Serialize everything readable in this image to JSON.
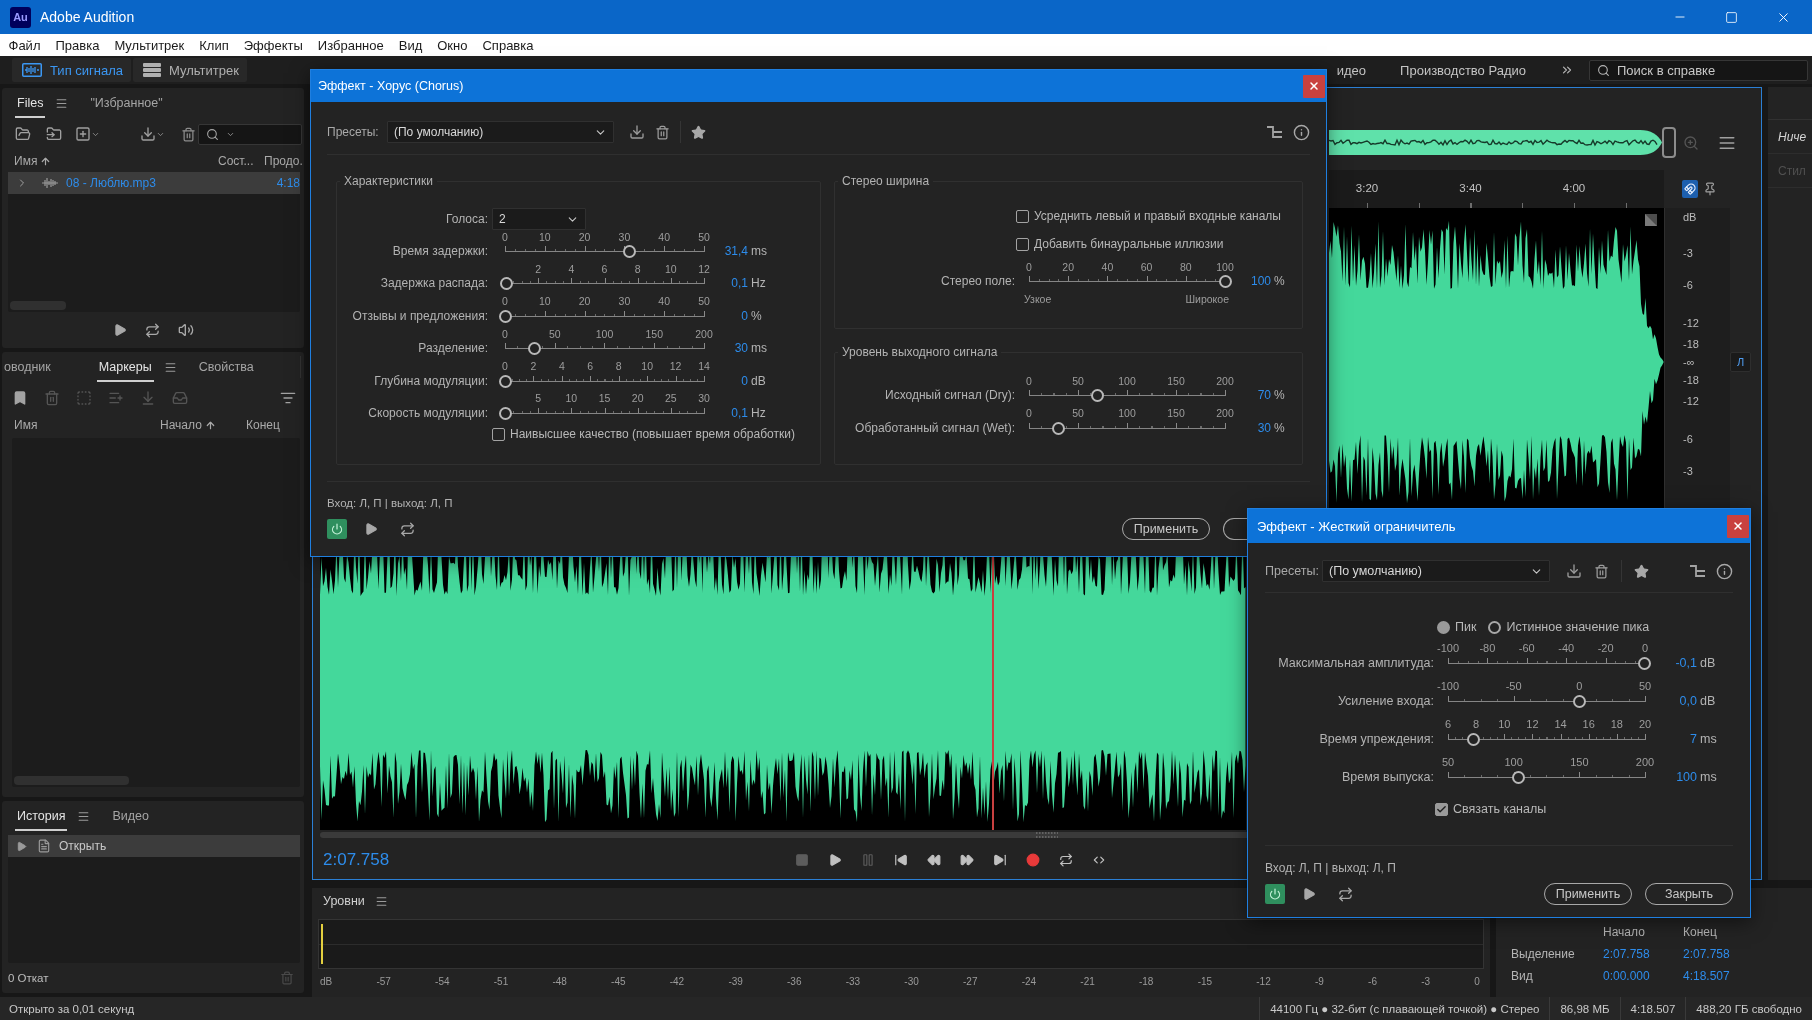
{
  "window": {
    "logo": "Au",
    "title": "Adobe Audition"
  },
  "menu": [
    "Файл",
    "Правка",
    "Мультитрек",
    "Клип",
    "Эффекты",
    "Избранное",
    "Вид",
    "Окно",
    "Справка"
  ],
  "toolbar": {
    "modes": [
      {
        "label": "Тип сигнала",
        "selected": true
      },
      {
        "label": "Мультитрек",
        "selected": false
      }
    ],
    "workspaces": [
      "идео",
      "Производство Радио"
    ],
    "search": {
      "placeholder": "Поиск в справке"
    }
  },
  "files_panel": {
    "tabs": [
      {
        "label": "Files",
        "selected": true
      },
      {
        "label": "\"Избранное\"",
        "selected": false
      }
    ],
    "columns": [
      {
        "label": "Имя",
        "sorted": true
      },
      {
        "label": "Сост...",
        "sorted": false
      },
      {
        "label": "Продо.",
        "sorted": false
      }
    ],
    "rows": [
      {
        "name": "08 - Люблю.mp3",
        "duration": "4:18",
        "selected": true,
        "expanded": false
      }
    ]
  },
  "markers_panel": {
    "tabs": [
      {
        "label": "оводник",
        "selected": false
      },
      {
        "label": "Маркеры",
        "selected": true
      },
      {
        "label": "Свойства",
        "selected": false
      }
    ],
    "columns": [
      {
        "label": "Имя",
        "sorted": false
      },
      {
        "label": "Начало",
        "sorted": true
      },
      {
        "label": "Конец",
        "sorted": false
      }
    ]
  },
  "history_panel": {
    "tabs": [
      {
        "label": "История",
        "selected": true
      },
      {
        "label": "Видео",
        "selected": false
      }
    ],
    "rows": [
      {
        "label": "Открыть",
        "selected": true
      }
    ],
    "undo_count": "0 Откат"
  },
  "editor": {
    "ruler": [
      "3:20",
      "3:40",
      "4:00"
    ],
    "scale": [
      "dB",
      "-3",
      "-6",
      "-12",
      "-18",
      "-∞",
      "-18",
      "-12",
      "-6",
      "-3"
    ],
    "channel_button": "Л",
    "time": "2:07.758"
  },
  "side_panel": {
    "items": [
      {
        "label": "Ниче",
        "kind": "value"
      },
      {
        "label": "Стил",
        "kind": "label"
      }
    ]
  },
  "levels": {
    "title": "Уровни",
    "scale": [
      "dB",
      "-57",
      "-54",
      "-51",
      "-48",
      "-45",
      "-42",
      "-39",
      "-36",
      "-33",
      "-30",
      "-27",
      "-24",
      "-21",
      "-18",
      "-15",
      "-12",
      "-9",
      "-6",
      "-3",
      "0"
    ]
  },
  "selection": {
    "columns": [
      "Начало",
      "Конец"
    ],
    "rows": [
      {
        "label": "Выделение",
        "start": "2:07.758",
        "end": "2:07.758"
      },
      {
        "label": "Вид",
        "start": "0:00.000",
        "end": "4:18.507"
      }
    ]
  },
  "chorus_dialog": {
    "title": "Эффект - Хорус (Chorus)",
    "presets_label": "Пресеты:",
    "preset": "(По умолчанию)",
    "characteristics": {
      "title": "Характеристики",
      "voices_label": "Голоса:",
      "voices": "2",
      "sliders": [
        {
          "label": "Время задержки:",
          "ticks": [
            "0",
            "10",
            "20",
            "30",
            "40",
            "50"
          ],
          "level": 0.628,
          "value": "31,4",
          "unit": "ms"
        },
        {
          "label": "Задержка распада:",
          "ticks": [
            "2",
            "4",
            "6",
            "8",
            "10",
            "12"
          ],
          "ticks_inset": true,
          "level": 0.008,
          "value": "0,1",
          "unit": "Hz"
        },
        {
          "label": "Отзывы и предложения:",
          "ticks": [
            "0",
            "10",
            "20",
            "30",
            "40",
            "50"
          ],
          "level": 0,
          "value": "0",
          "unit": "%"
        },
        {
          "label": "Разделение:",
          "ticks": [
            "0",
            "50",
            "100",
            "150",
            "200"
          ],
          "level": 0.15,
          "value": "30",
          "unit": "ms"
        },
        {
          "label": "Глубина модуляции:",
          "ticks": [
            "0",
            "2",
            "4",
            "6",
            "8",
            "10",
            "12",
            "14"
          ],
          "level": 0,
          "value": "0",
          "unit": "dB"
        },
        {
          "label": "Скорость модуляции:",
          "ticks": [
            "5",
            "10",
            "15",
            "20",
            "25",
            "30"
          ],
          "ticks_inset": true,
          "level": 0.003,
          "value": "0,1",
          "unit": "Hz"
        }
      ],
      "quality": {
        "label": "Наивысшее качество (повышает время обработки)",
        "checked": false
      }
    },
    "stereo": {
      "title": "Стерео ширина",
      "options": [
        {
          "label": "Усреднить левый и правый входные каналы",
          "checked": false
        },
        {
          "label": "Добавить бинауральные иллюзии",
          "checked": false
        }
      ],
      "slider": {
        "label": "Стерео поле:",
        "ticks": [
          "0",
          "20",
          "40",
          "60",
          "80",
          "100"
        ],
        "level": 1,
        "value": "100",
        "unit": "%"
      },
      "range_labels": [
        "Узкое",
        "Широкое"
      ]
    },
    "output": {
      "title": "Уровень выходного сигнала",
      "sliders": [
        {
          "label": "Исходный сигнал (Dry):",
          "ticks": [
            "0",
            "50",
            "100",
            "150",
            "200"
          ],
          "level": 0.35,
          "value": "70",
          "unit": "%"
        },
        {
          "label": "Обработанный сигнал (Wet):",
          "ticks": [
            "0",
            "50",
            "100",
            "150",
            "200"
          ],
          "level": 0.15,
          "value": "30",
          "unit": "%"
        }
      ]
    },
    "io": "Вход: Л, П | выход: Л, П",
    "power_on": true,
    "buttons": [
      "Применить"
    ]
  },
  "limiter_dialog": {
    "title": "Эффект - Жесткий ограничитель",
    "presets_label": "Пресеты:",
    "preset": "(По умолчанию)",
    "modes": [
      {
        "label": "Пик",
        "selected": true
      },
      {
        "label": "Истинное значение пика",
        "selected": false
      }
    ],
    "sliders": [
      {
        "label": "Максимальная амплитуда:",
        "ticks": [
          "-100",
          "-80",
          "-60",
          "-40",
          "-20",
          "0"
        ],
        "level": 0.999,
        "value": "-0,1",
        "unit": "dB"
      },
      {
        "label": "Усиление входа:",
        "ticks": [
          "-100",
          "-50",
          "0",
          "50"
        ],
        "level": 0.667,
        "value": "0,0",
        "unit": "dB"
      },
      {
        "label": "Время упреждения:",
        "ticks": [
          "6",
          "8",
          "10",
          "12",
          "14",
          "16",
          "18",
          "20"
        ],
        "level": 0.13,
        "value": "7",
        "unit": "ms"
      },
      {
        "label": "Время выпуска:",
        "ticks": [
          "50",
          "100",
          "150",
          "200"
        ],
        "level": 0.36,
        "value": "100",
        "unit": "ms"
      }
    ],
    "link": {
      "label": "Связать каналы",
      "checked": true
    },
    "io": "Вход: Л, П | выход: Л, П",
    "power_on": true,
    "buttons": [
      "Применить",
      "Закрыть"
    ]
  },
  "status_bar": {
    "message": "Открыто за 0,01 секунд",
    "items": [
      "44100 Гц ● 32-бит (с плавающей точкой) ● Стерео",
      "86,98 МБ",
      "4:18.507",
      "488,20 ГБ свободно"
    ]
  }
}
